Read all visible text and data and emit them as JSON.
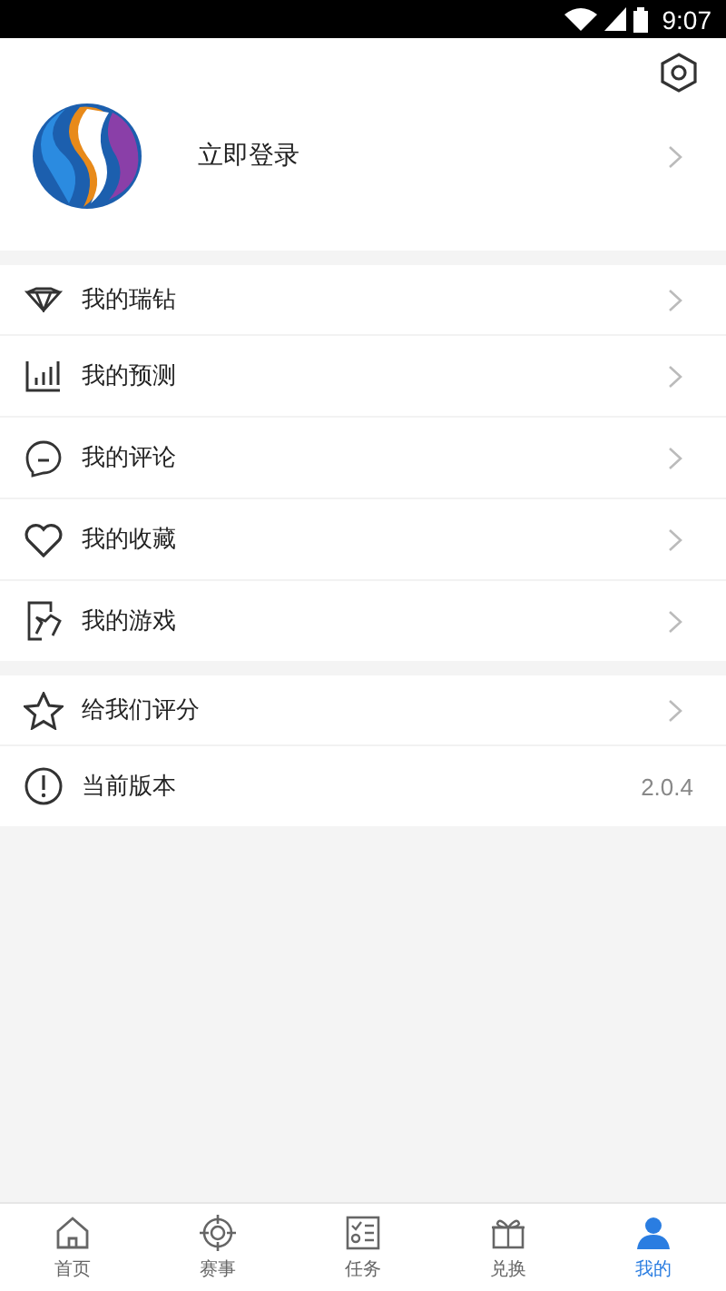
{
  "status_bar": {
    "time": "9:07"
  },
  "profile": {
    "login_label": "立即登录"
  },
  "menu_groups": [
    [
      {
        "label": "我的瑞钻"
      },
      {
        "label": "我的预测"
      },
      {
        "label": "我的评论"
      },
      {
        "label": "我的收藏"
      },
      {
        "label": "我的游戏"
      }
    ],
    [
      {
        "label": "给我们评分"
      },
      {
        "label": "当前版本",
        "value": "2.0.4"
      }
    ]
  ],
  "tab_bar": [
    {
      "label": "首页",
      "selected": false
    },
    {
      "label": "赛事",
      "selected": false
    },
    {
      "label": "任务",
      "selected": false
    },
    {
      "label": "兑换",
      "selected": false
    },
    {
      "label": "我的",
      "selected": true
    }
  ]
}
